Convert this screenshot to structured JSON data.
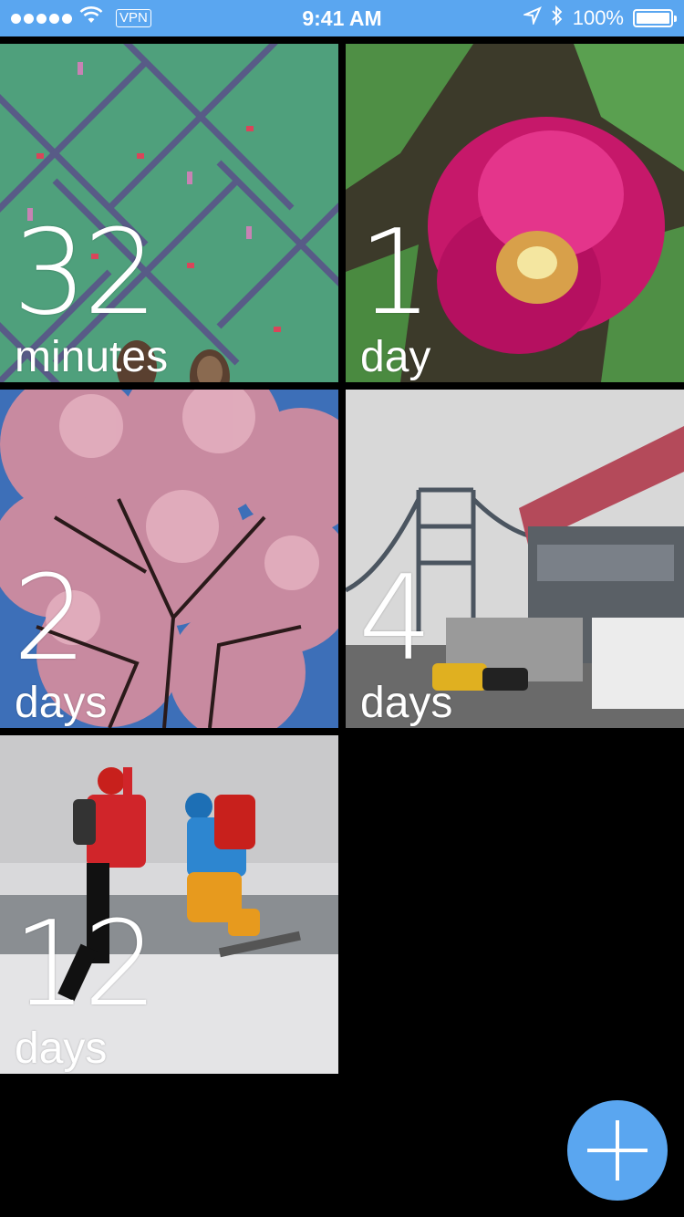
{
  "status_bar": {
    "signal_dots": 5,
    "vpn_label": "VPN",
    "time": "9:41 AM",
    "battery_text": "100%",
    "battery_level": 1.0,
    "background_color": "#5aa6f0"
  },
  "tiles": [
    {
      "count": "32",
      "unit": "minutes",
      "photo": "carpet-feet"
    },
    {
      "count": "1",
      "unit": "day",
      "photo": "pink-tulip"
    },
    {
      "count": "2",
      "unit": "days",
      "photo": "cherry-blossom"
    },
    {
      "count": "4",
      "unit": "days",
      "photo": "bridge-street"
    },
    {
      "count": "12",
      "unit": "days",
      "photo": "snow-hikers"
    }
  ],
  "fab": {
    "icon": "plus-icon",
    "color": "#5aa6f0"
  }
}
